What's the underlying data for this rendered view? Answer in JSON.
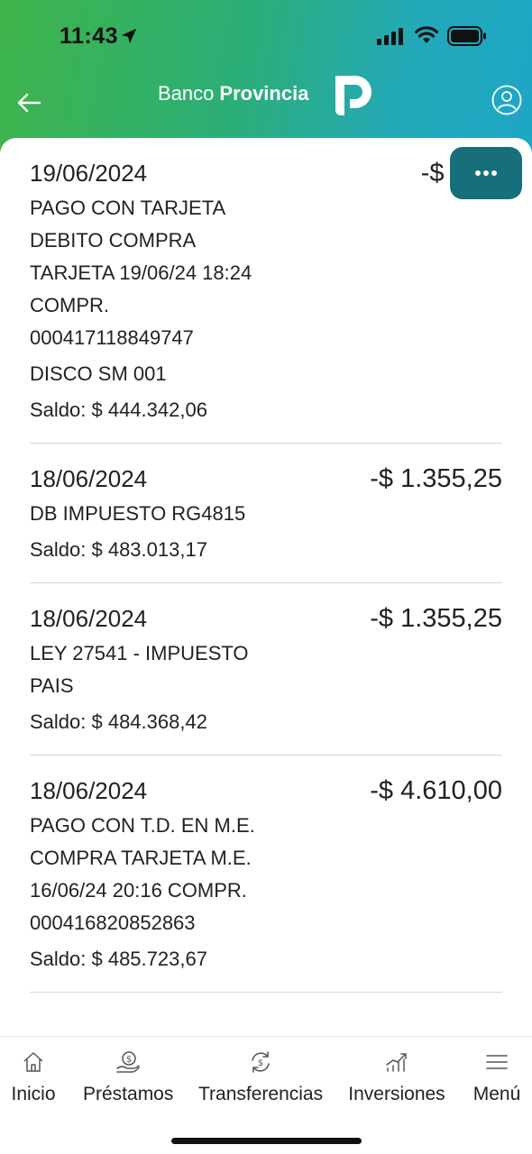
{
  "status_bar": {
    "time": "11:43"
  },
  "header": {
    "brand_light": "Banco",
    "brand_bold": "Provincia",
    "colors": {
      "gradient_start": "#3fb44a",
      "gradient_end": "#1ea6c6"
    }
  },
  "transactions": [
    {
      "date": "19/06/2024",
      "amount": "-$ 38.6",
      "description": "PAGO CON TARJETA\nDEBITO COMPRA\nTARJETA 19/06/24 18:24\nCOMPR.\n000417118849747",
      "merchant": "DISCO SM 001",
      "balance": "Saldo: $ 444.342,06"
    },
    {
      "date": "18/06/2024",
      "amount": "-$ 1.355,25",
      "description": "DB IMPUESTO RG4815",
      "balance": "Saldo: $ 483.013,17"
    },
    {
      "date": "18/06/2024",
      "amount": "-$ 1.355,25",
      "description": "LEY 27541 - IMPUESTO\nPAIS",
      "balance": "Saldo: $ 484.368,42"
    },
    {
      "date": "18/06/2024",
      "amount": "-$ 4.610,00",
      "description": "PAGO CON T.D. EN M.E.\nCOMPRA TARJETA M.E.\n16/06/24 20:16 COMPR.\n000416820852863",
      "balance": "Saldo: $ 485.723,67"
    }
  ],
  "more_button": {
    "icon": "ellipsis-icon",
    "color": "#176f7b"
  },
  "bottom_nav": [
    {
      "label": "Inicio",
      "icon": "home-icon"
    },
    {
      "label": "Préstamos",
      "icon": "loan-icon"
    },
    {
      "label": "Transferencias",
      "icon": "transfer-icon"
    },
    {
      "label": "Inversiones",
      "icon": "investments-icon"
    },
    {
      "label": "Menú",
      "icon": "menu-icon"
    }
  ]
}
